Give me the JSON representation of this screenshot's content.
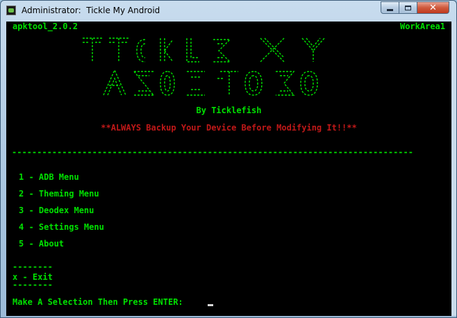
{
  "window": {
    "title": "Administrator:  Tickle My Android"
  },
  "console": {
    "header_left": "apktool_2.0.2",
    "header_right": "WorkArea1",
    "byline": "By Ticklefish",
    "warning": "**ALWAYS Backup Your Device Before Modifying It!!**",
    "separator": "--------------------------------------------------------------------------------",
    "menu_items": [
      "1 - ADB Menu",
      "2 - Theming Menu",
      "3 - Deodex Menu",
      "4 - Settings Menu",
      "5 - About"
    ],
    "exit_rule": "--------",
    "exit_label": "x - Exit",
    "prompt": "Make A Selection Then Press ENTER: "
  },
  "colors": {
    "console_bg": "#000000",
    "text_green": "#00e000",
    "warning_red": "#c01818"
  }
}
